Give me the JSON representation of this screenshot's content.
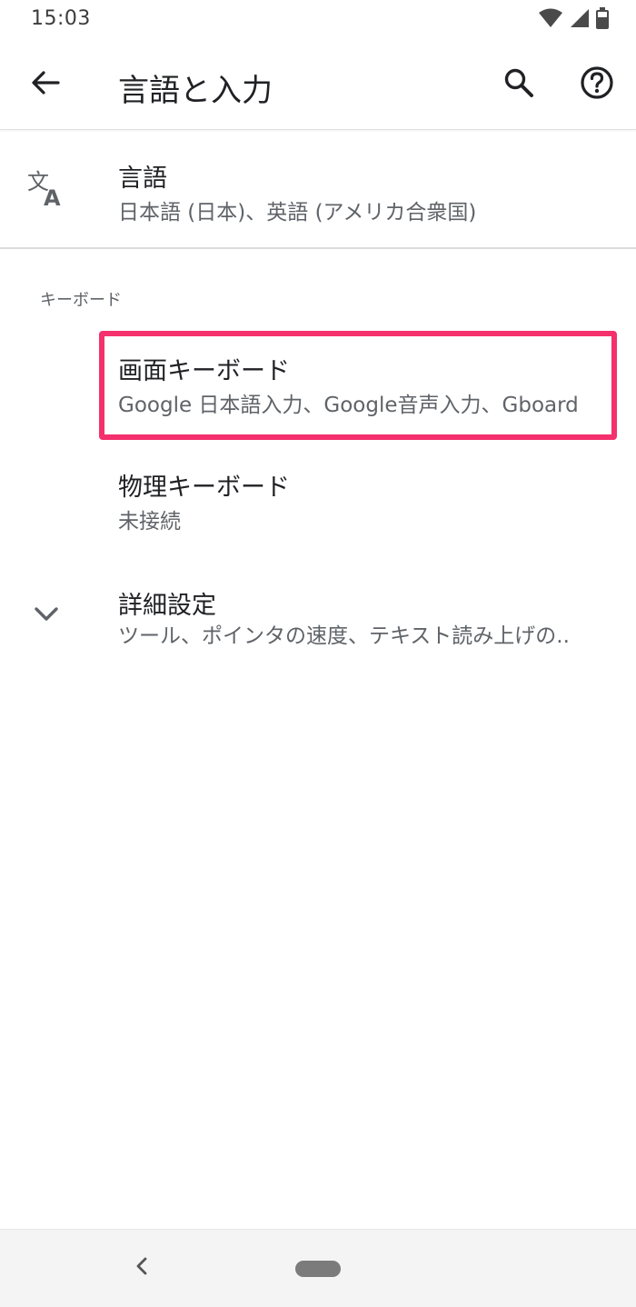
{
  "status_bar": {
    "time": "15:03",
    "icons": [
      "wifi-icon",
      "cell-signal-icon",
      "battery-icon"
    ]
  },
  "app_bar": {
    "title": "言語と入力",
    "back_icon": "arrow-back-icon",
    "search_icon": "search-icon",
    "help_icon": "help-icon"
  },
  "language": {
    "icon": "translate-icon",
    "title": "言語",
    "summary": "日本語 (日本)、英語 (アメリカ合衆国)"
  },
  "keyboard_section": {
    "header": "キーボード",
    "items": [
      {
        "title": "画面キーボード",
        "summary": "Google 日本語入力、Google音声入力、Gboard",
        "highlighted": true
      },
      {
        "title": "物理キーボード",
        "summary": "未接続"
      }
    ]
  },
  "advanced": {
    "icon": "chevron-down-icon",
    "title": "詳細設定",
    "summary": "ツール、ポインタの速度、テキスト読み上げの.."
  },
  "nav_bar": {
    "back_icon": "nav-back-icon",
    "home_icon": "home-pill-icon"
  },
  "colors": {
    "highlight": "#f4306d",
    "text_primary": "#202124",
    "text_secondary": "#5f6368"
  }
}
